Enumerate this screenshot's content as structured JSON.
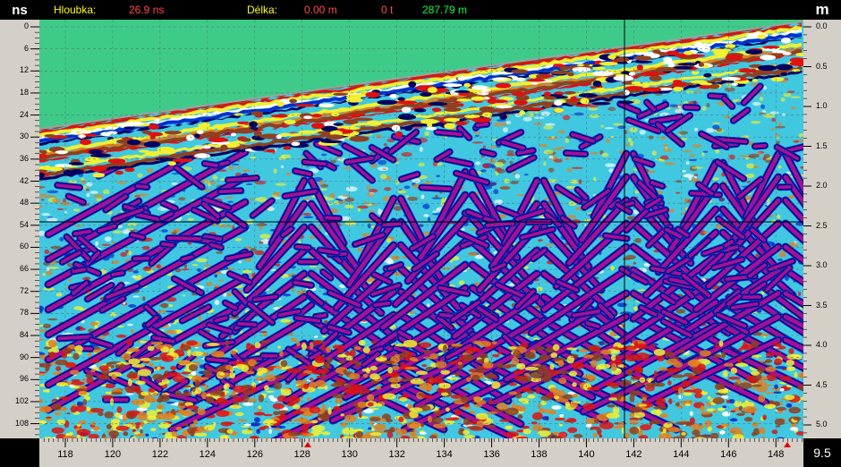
{
  "header": {
    "depth_unit": "ns",
    "right_unit": "m",
    "hloubka_label": "Hloubka:",
    "hloubka_value": "26.9 ns",
    "delka_label": "Délka:",
    "delka_value": "0.00 m",
    "t_value": "0 t",
    "distance_value": "287.79 m"
  },
  "left_axis_ticks": [
    "0",
    "6",
    "12",
    "18",
    "24",
    "30",
    "36",
    "42",
    "48",
    "54",
    "60",
    "66",
    "72",
    "78",
    "84",
    "90",
    "96",
    "102",
    "108"
  ],
  "right_axis_ticks": [
    "0.0",
    "0.5",
    "1.0",
    "1.5",
    "2.0",
    "2.5",
    "3.0",
    "3.5",
    "4.0",
    "4.5",
    "5.0"
  ],
  "bottom_axis_ticks": [
    "118",
    "120",
    "122",
    "124",
    "126",
    "128",
    "130",
    "132",
    "134",
    "136",
    "138",
    "140",
    "142",
    "144",
    "146",
    "148"
  ],
  "corner_value": "9.5",
  "colors": {
    "air": "#3ecb8a",
    "magenta": "#a0109c",
    "navy": "#000060",
    "blue": "#0030d0",
    "cyan": "#40c8e0",
    "yellow": "#f0f030",
    "orange": "#e08020",
    "red": "#e01010",
    "brown": "#904020",
    "white": "#ffffff"
  }
}
